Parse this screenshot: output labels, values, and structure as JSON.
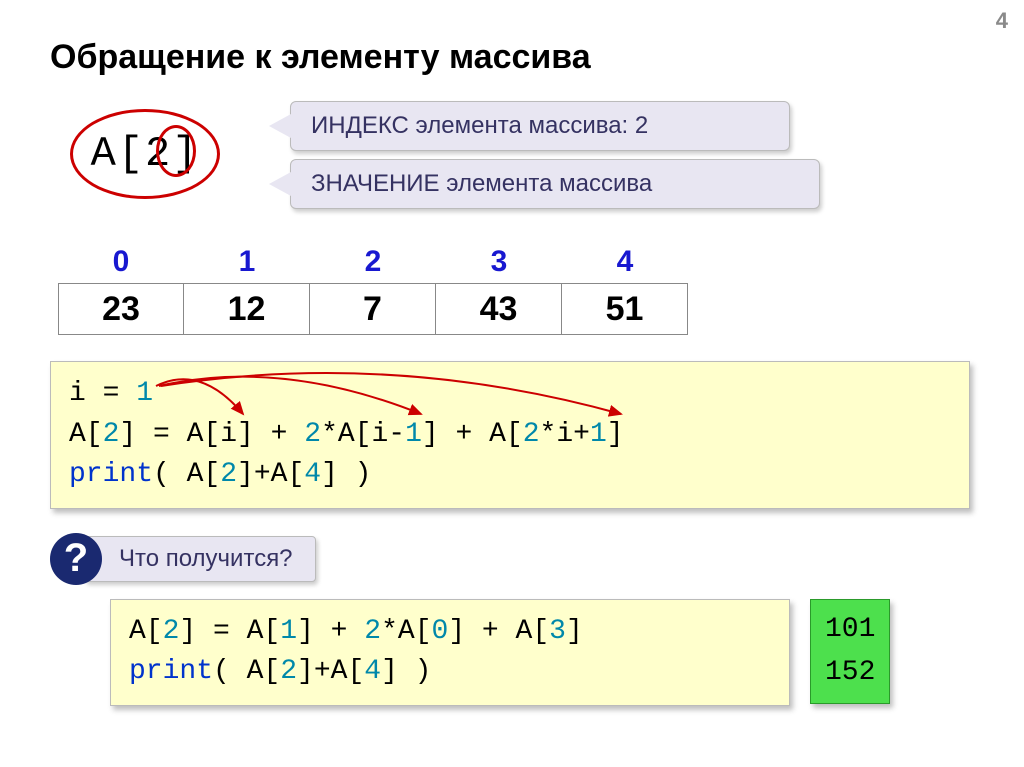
{
  "page_number": "4",
  "title": "Обращение к элементу массива",
  "expression": "A[2]",
  "callout_index": "ИНДЕКС элемента массива: 2",
  "callout_value": "ЗНАЧЕНИЕ элемента массива",
  "array": {
    "indices": [
      "0",
      "1",
      "2",
      "3",
      "4"
    ],
    "values": [
      "23",
      "12",
      "7",
      "43",
      "51"
    ]
  },
  "code1": {
    "l1_a": "i = ",
    "l1_b": "1",
    "l2_a": "A[",
    "l2_b": "2",
    "l2_c": "] = A[i] + ",
    "l2_d": "2",
    "l2_e": "*A[i-",
    "l2_f": "1",
    "l2_g": "] + A[",
    "l2_h": "2",
    "l2_i": "*i+",
    "l2_j": "1",
    "l2_k": "]",
    "l3_a": "print",
    "l3_b": "( A[",
    "l3_c": "2",
    "l3_d": "]+A[",
    "l3_e": "4",
    "l3_f": "] )"
  },
  "question_label": "Что получится?",
  "code2": {
    "l1_a": "A[",
    "l1_b": "2",
    "l1_c": "] = A[",
    "l1_d": "1",
    "l1_e": "] + ",
    "l1_f": "2",
    "l1_g": "*A[",
    "l1_h": "0",
    "l1_i": "] + A[",
    "l1_j": "3",
    "l1_k": "]",
    "l2_a": "print",
    "l2_b": "( A[",
    "l2_c": "2",
    "l2_d": "]+A[",
    "l2_e": "4",
    "l2_f": "] )"
  },
  "results": {
    "r1": "101",
    "r2": "152"
  }
}
